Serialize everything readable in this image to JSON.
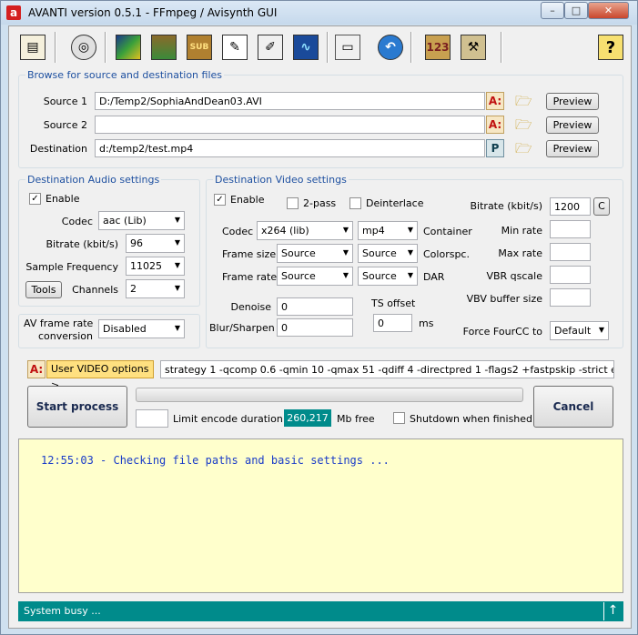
{
  "window": {
    "title": "AVANTI  version  0.5.1  -  FFmpeg / Avisynth GUI",
    "app_icon": "a"
  },
  "window_controls": {
    "minimize": "–",
    "maximize": "□",
    "close": "✕"
  },
  "toolbar": {
    "help": "?",
    "counter": "123"
  },
  "browse": {
    "legend": "Browse for source and destination files",
    "source1_label": "Source 1",
    "source1_value": "D:/Temp2/SophiaAndDean03.AVI",
    "source2_label": "Source 2",
    "source2_value": "",
    "dest_label": "Destination",
    "dest_value": "d:/temp2/test.mp4",
    "preview_label": "Preview",
    "font_glyph": "A:",
    "p_glyph": "P"
  },
  "audio": {
    "legend": "Destination Audio settings",
    "enable_label": "Enable",
    "enable_checked": true,
    "codec_label": "Codec",
    "codec_value": "aac (Lib)",
    "bitrate_label": "Bitrate (kbit/s)",
    "bitrate_value": "96",
    "freq_label": "Sample Frequency",
    "freq_value": "11025",
    "tools_label": "Tools",
    "channels_label": "Channels",
    "channels_value": "2"
  },
  "avframe": {
    "label_line1": "AV frame rate",
    "label_line2": "conversion",
    "value": "Disabled"
  },
  "video": {
    "legend": "Destination Video settings",
    "enable_label": "Enable",
    "enable_checked": true,
    "twopass_label": "2-pass",
    "twopass_checked": false,
    "deinterlace_label": "Deinterlace",
    "deinterlace_checked": false,
    "codec_label": "Codec",
    "codec_value": "x264 (lib)",
    "container_value": "mp4",
    "container_label": "Container",
    "framesize_label": "Frame size",
    "framesize_value": "Source",
    "colorspc_value": "Source",
    "colorspc_label": "Colorspc.",
    "framerate_label": "Frame rate",
    "framerate_value": "Source",
    "dar_value": "Source",
    "dar_label": "DAR",
    "denoise_label": "Denoise",
    "denoise_value": "0",
    "blur_label": "Blur/Sharpen",
    "blur_value": "0",
    "ts_label": "TS offset",
    "ts_value": "0",
    "ts_unit": "ms",
    "bitrate_label": "Bitrate (kbit/s)",
    "bitrate_value": "1200",
    "c_button": "C",
    "minrate_label": "Min rate",
    "minrate_value": "",
    "maxrate_label": "Max rate",
    "maxrate_value": "",
    "vbr_label": "VBR qscale",
    "vbr_value": "",
    "vbv_label": "VBV buffer size",
    "vbv_value": "",
    "fourcc_label": "Force FourCC to",
    "fourcc_value": "Default"
  },
  "user_options": {
    "label": "User VIDEO options >",
    "value": "strategy 1 -qcomp 0.6 -qmin 10 -qmax 51 -qdiff 4 -directpred 1 -flags2 +fastpskip -strict experimental"
  },
  "process": {
    "start_label": "Start process",
    "cancel_label": "Cancel",
    "limit_value": "",
    "limit_label": "Limit encode duration",
    "free_value": "260,217",
    "free_label": "Mb free",
    "shutdown_label": "Shutdown when finished",
    "shutdown_checked": false,
    "progress": 0
  },
  "log": {
    "line": "12:55:03 - Checking file paths and basic settings ..."
  },
  "status": {
    "text": "System busy ...",
    "button": "↑"
  },
  "colors": {
    "accent": "#008b8b",
    "legend": "#1e50a0",
    "log_bg": "#ffffcc",
    "log_text": "#1a3cc8"
  }
}
